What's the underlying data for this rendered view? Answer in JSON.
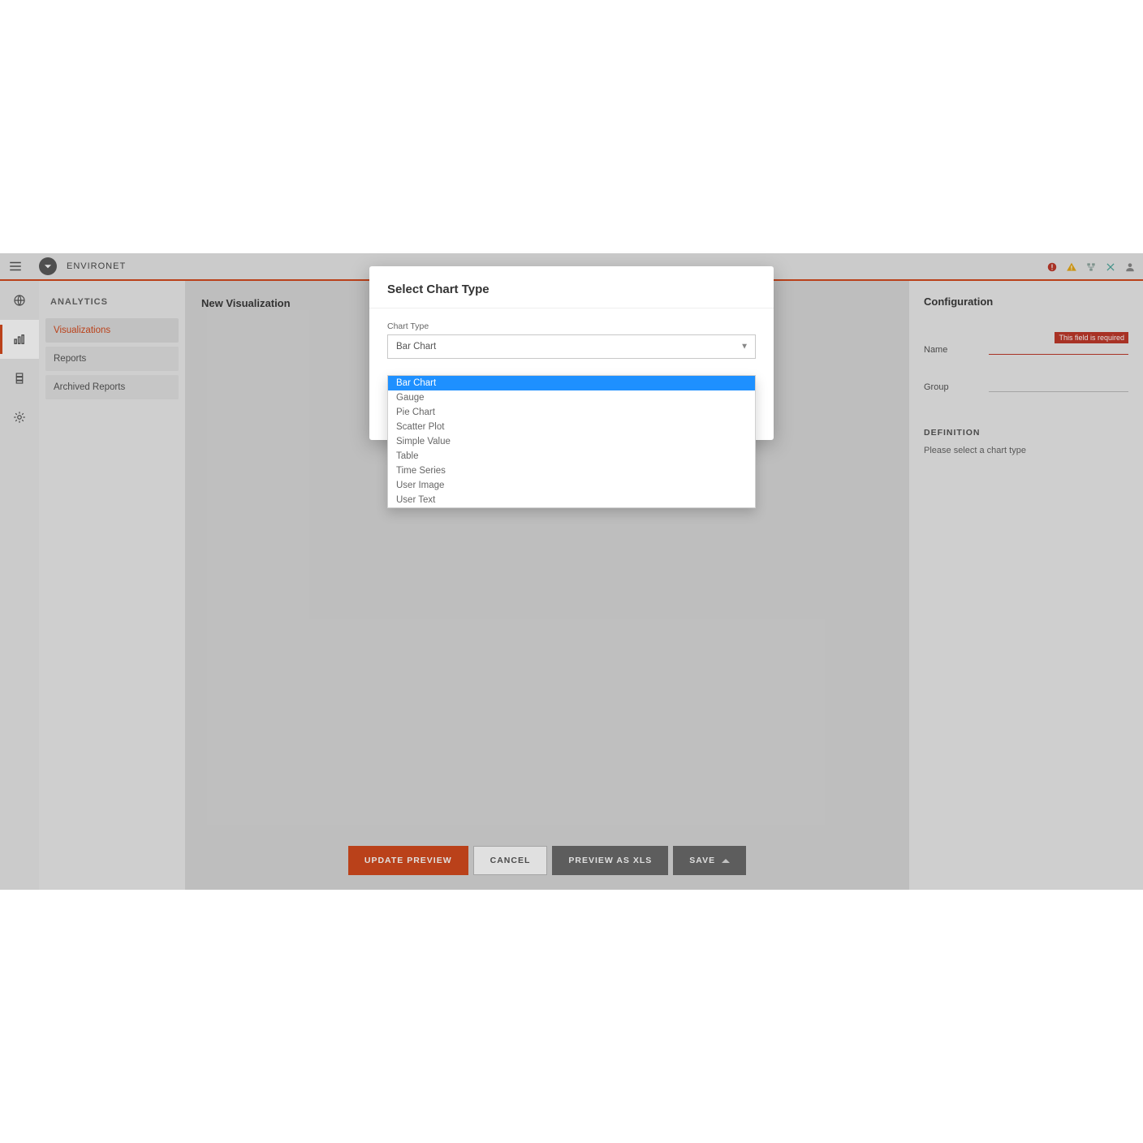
{
  "topbar": {
    "app_title": "ENVIRONET"
  },
  "iconrail": {
    "items": [
      "globe-icon",
      "chart-icon",
      "server-icon",
      "gear-icon"
    ],
    "active_index": 1
  },
  "sidebar": {
    "header": "ANALYTICS",
    "items": [
      {
        "label": "Visualizations",
        "active": true
      },
      {
        "label": "Reports",
        "active": false
      },
      {
        "label": "Archived Reports",
        "active": false
      }
    ]
  },
  "main": {
    "title": "New Visualization",
    "buttons": {
      "update_preview": "UPDATE PREVIEW",
      "cancel": "CANCEL",
      "preview_xls": "PREVIEW AS XLS",
      "save": "SAVE"
    }
  },
  "config": {
    "title": "Configuration",
    "name_label": "Name",
    "name_value": "",
    "name_error": "This field is required",
    "group_label": "Group",
    "group_value": "",
    "definition_header": "DEFINITION",
    "definition_text": "Please select a chart type"
  },
  "modal": {
    "title": "Select Chart Type",
    "field_label": "Chart Type",
    "selected": "Bar Chart",
    "options": [
      "Bar Chart",
      "Gauge",
      "Pie Chart",
      "Scatter Plot",
      "Simple Value",
      "Table",
      "Time Series",
      "User Image",
      "User Text"
    ],
    "highlight_index": 0
  }
}
